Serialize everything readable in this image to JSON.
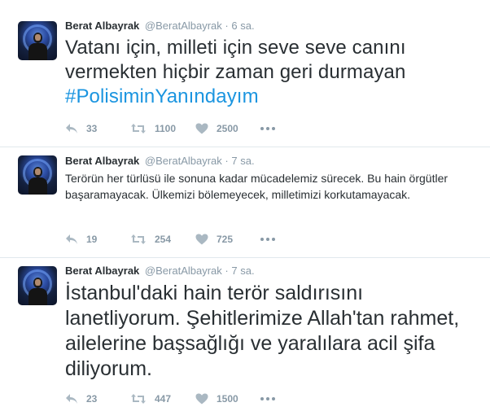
{
  "tweets": [
    {
      "fullname": "Berat Albayrak",
      "username": "@BeratAlbayrak",
      "separator": "·",
      "time": "6 sa.",
      "text": "Vatanı için, milleti için seve seve canını vermekten hiçbir zaman geri durmayan ",
      "hashtag": "#PolisiminYanındayım",
      "replies": "33",
      "retweets": "1100",
      "likes": "2500"
    },
    {
      "fullname": "Berat Albayrak",
      "username": "@BeratAlbayrak",
      "separator": "·",
      "time": "7 sa.",
      "text": "Terörün her türlüsü ile sonuna kadar mücadelemiz sürecek. Bu hain örgütler başaramayacak. Ülkemizi bölemeyecek, milletimizi korkutamayacak.",
      "replies": "19",
      "retweets": "254",
      "likes": "725"
    },
    {
      "fullname": "Berat Albayrak",
      "username": "@BeratAlbayrak",
      "separator": "·",
      "time": "7 sa.",
      "text": "İstanbul'daki hain terör saldırısını lanetliyorum. Şehitlerimize Allah'tan rahmet, ailelerine başsağlığı ve yaralılara acil şifa diliyorum.",
      "replies": "23",
      "retweets": "447",
      "likes": "1500"
    }
  ],
  "icons": {
    "reply": "reply-icon",
    "retweet": "retweet-icon",
    "like": "heart-icon",
    "more": "more-dots-icon"
  },
  "colors": {
    "hashtag": "#1b95e0",
    "muted": "#8899a6",
    "text": "#292f33",
    "divider": "#e1e8ed"
  }
}
